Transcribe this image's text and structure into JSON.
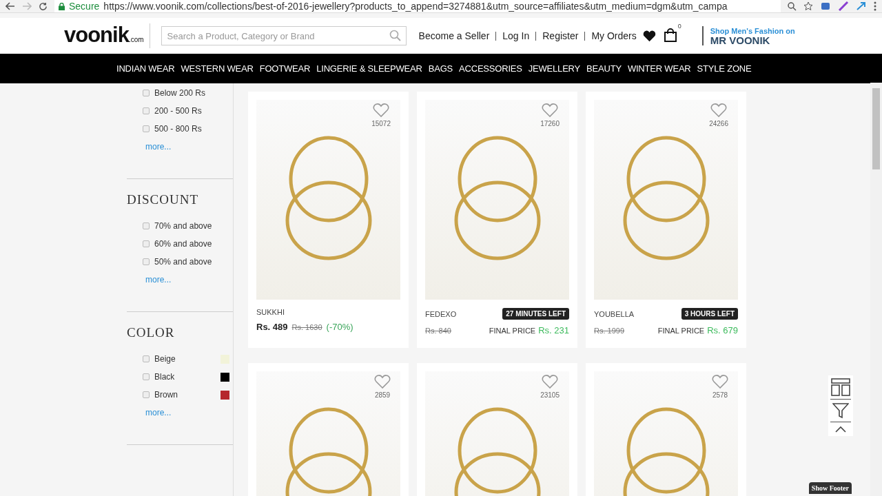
{
  "browser": {
    "secure_label": "Secure",
    "url": "https://www.voonik.com/collections/best-of-2016-jewellery?products_to_append=3274881&utm_source=affiliates&utm_medium=dgm&utm_campa"
  },
  "header": {
    "logo": "voonik",
    "logo_suffix": ".com",
    "search": {
      "placeholder": "Search a Product, Category or Brand"
    },
    "links": [
      "Become a Seller",
      "Log In",
      "Register",
      "My Orders"
    ],
    "cart_count": "0",
    "promo": {
      "line1": "Shop Men's Fashion on",
      "line2": "MR VOONIK"
    }
  },
  "nav": [
    "INDIAN WEAR",
    "WESTERN WEAR",
    "FOOTWEAR",
    "LINGERIE & SLEEPWEAR",
    "BAGS",
    "ACCESSORIES",
    "JEWELLERY",
    "BEAUTY",
    "WINTER WEAR",
    "STYLE ZONE"
  ],
  "filters": [
    {
      "options": [
        {
          "label": "Below 200 Rs",
          "checked": false
        },
        {
          "label": "200 - 500 Rs",
          "checked": false
        },
        {
          "label": "500 - 800 Rs",
          "checked": false
        }
      ],
      "more": "more..."
    },
    {
      "title": "DISCOUNT",
      "options": [
        {
          "label": "70% and above",
          "checked": false
        },
        {
          "label": "60% and above",
          "checked": false
        },
        {
          "label": "50% and above",
          "checked": false
        }
      ],
      "more": "more..."
    },
    {
      "title": "COLOR",
      "options": [
        {
          "label": "Beige",
          "checked": false,
          "color": "#f2f3d9"
        },
        {
          "label": "Black",
          "checked": false,
          "color": "#000000"
        },
        {
          "label": "Brown",
          "checked": false,
          "color": "#b5272d"
        }
      ],
      "more": "more..."
    }
  ],
  "products": [
    {
      "kind": "discount",
      "likes": "15072",
      "brand": "SUKKHI",
      "price": "Rs. 489",
      "mrp": "Rs. 1630",
      "off": "(-70%)"
    },
    {
      "kind": "deal",
      "likes": "17260",
      "brand": "FEDEXO",
      "timer": "27 MINUTES LEFT",
      "mrp": "Rs. 840",
      "final_label": "FINAL PRICE",
      "price": "Rs. 231"
    },
    {
      "kind": "deal",
      "likes": "24266",
      "brand": "YOUBELLA",
      "timer": "3 HOURS LEFT",
      "mrp": "Rs. 1999",
      "final_label": "FINAL PRICE",
      "price": "Rs. 679"
    },
    {
      "kind": "image_only",
      "likes": "2859"
    },
    {
      "kind": "image_only",
      "likes": "23105"
    },
    {
      "kind": "image_only",
      "likes": "2578"
    }
  ],
  "show_footer": "Show Footer"
}
